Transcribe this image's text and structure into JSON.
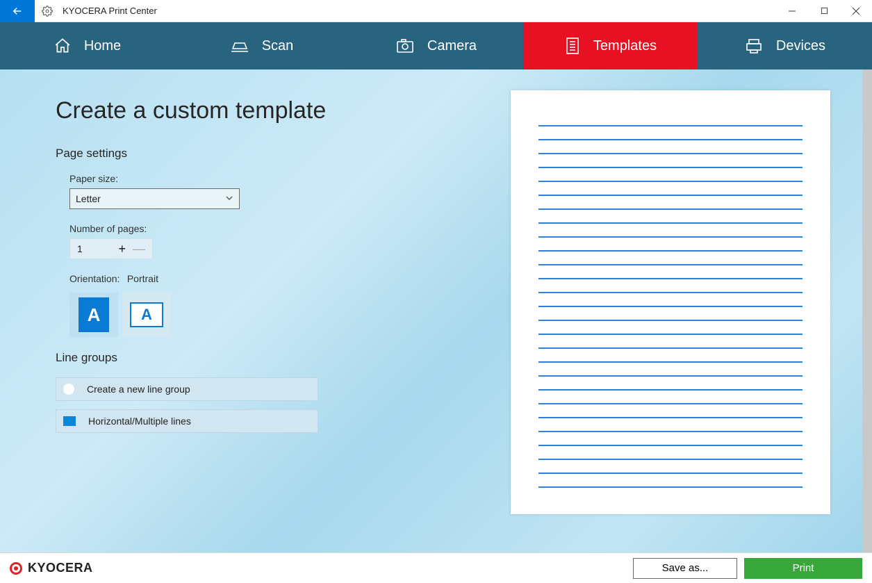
{
  "titlebar": {
    "app_title": "KYOCERA Print Center"
  },
  "nav": {
    "home": "Home",
    "scan": "Scan",
    "camera": "Camera",
    "templates": "Templates",
    "devices": "Devices"
  },
  "page": {
    "title": "Create a custom template",
    "page_settings_label": "Page settings",
    "paper_size_label": "Paper size:",
    "paper_size_value": "Letter",
    "num_pages_label": "Number of pages:",
    "num_pages_value": "1",
    "orientation_label": "Orientation:",
    "orientation_value": "Portrait",
    "glyph_A": "A",
    "line_groups_label": "Line groups",
    "lg_create": "Create a new line group",
    "lg_item1": "Horizontal/Multiple lines"
  },
  "footer": {
    "brand": "KYOCERA",
    "save_as": "Save as...",
    "print": "Print"
  },
  "preview": {
    "line_count": 27
  }
}
